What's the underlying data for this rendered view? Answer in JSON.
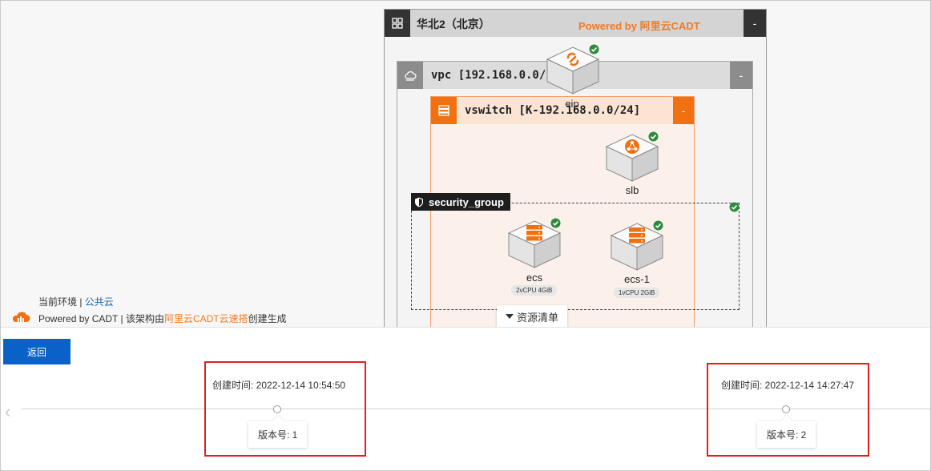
{
  "region": {
    "title": "华北2（北京）",
    "powered": "Powered by 阿里云CADT",
    "collapse": "-"
  },
  "vpc": {
    "title": "vpc [192.168.0.0/1",
    "collapse": "-"
  },
  "vswitch": {
    "title": "vswitch [K-192.168.0.0/24]",
    "collapse": "-"
  },
  "security_group": {
    "label": "security_group"
  },
  "nodes": {
    "eip": {
      "label": "eip"
    },
    "slb": {
      "label": "slb"
    },
    "ecs": {
      "label": "ecs",
      "spec": "2vCPU 4GiB"
    },
    "ecs1": {
      "label": "ecs-1",
      "spec": "1vCPU 2GiB"
    }
  },
  "resource_list": {
    "label": "资源清单"
  },
  "footer": {
    "env_prefix": "当前环境 |",
    "env_value": "公共云",
    "powered_prefix": "Powered by CADT | 该架构由",
    "powered_link": "阿里云CADT云速搭",
    "powered_suffix": "创建生成"
  },
  "bottom": {
    "back_label": "返回",
    "versions": [
      {
        "time": "创建时间: 2022-12-14 10:54:50",
        "version": "版本号: 1"
      },
      {
        "time": "创建时间: 2022-12-14 14:27:47",
        "version": "版本号: 2"
      }
    ]
  },
  "colors": {
    "accent": "#f07012",
    "primary": "#0a62c8",
    "ok": "#2e8b3e",
    "highlight": "#e0201f"
  }
}
